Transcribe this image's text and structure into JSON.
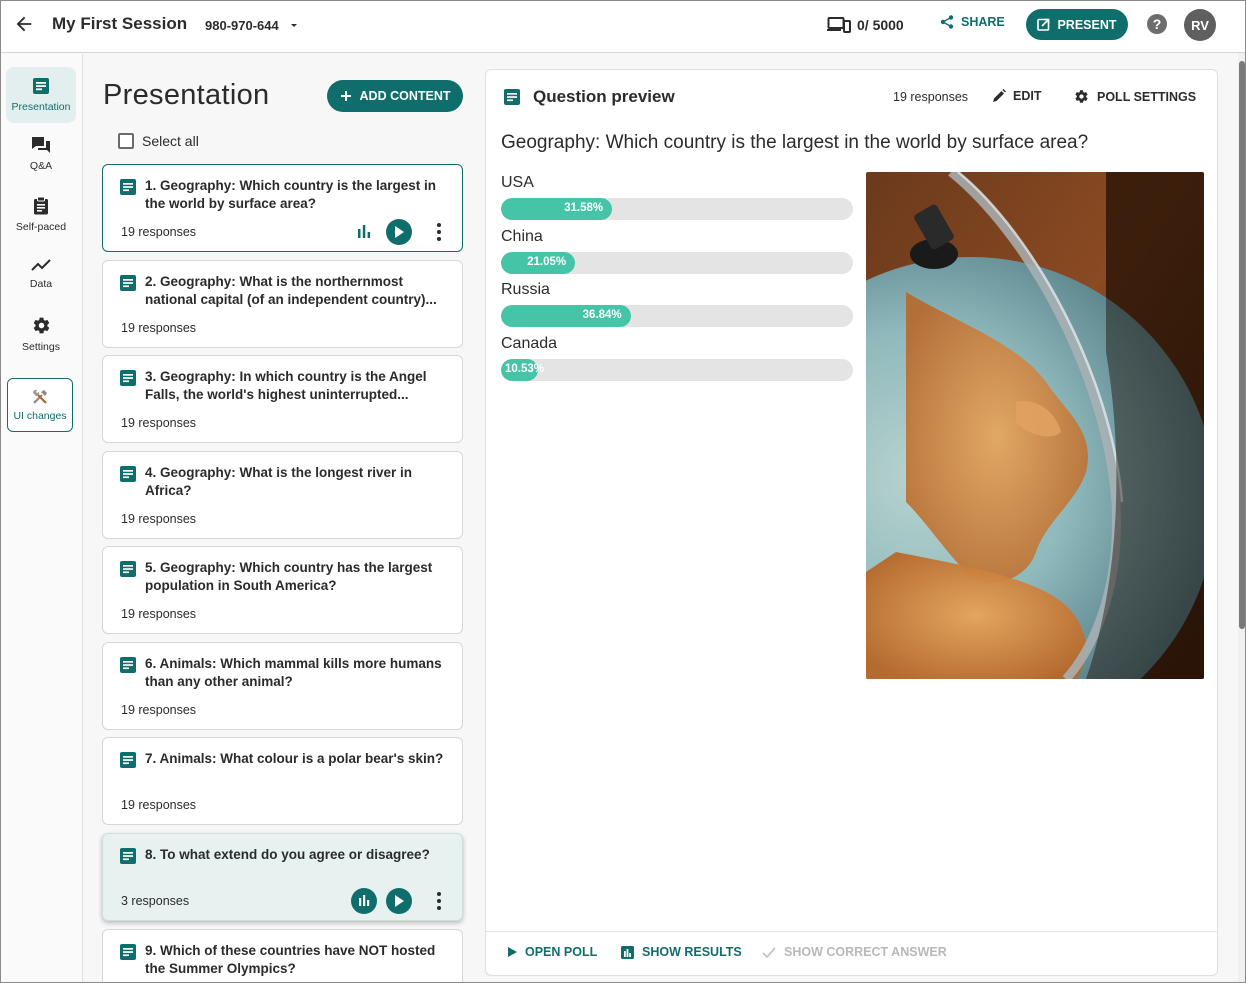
{
  "header": {
    "session_title": "My First Session",
    "session_code": "980-970-644",
    "device_count": "0/ 5000",
    "share_label": "SHARE",
    "present_label": "PRESENT",
    "help_label": "?",
    "avatar_initials": "RV"
  },
  "rail": {
    "items": [
      {
        "label": "Presentation"
      },
      {
        "label": "Q&A"
      },
      {
        "label": "Self-paced"
      },
      {
        "label": "Data"
      },
      {
        "label": "Settings"
      }
    ],
    "ui_changes_label": "UI changes"
  },
  "presentation": {
    "title": "Presentation",
    "add_content_label": "ADD CONTENT",
    "select_all_label": "Select all",
    "questions": [
      {
        "text": "1. Geography: Which country is the largest in the world by surface area?",
        "responses": "19 responses"
      },
      {
        "text": "2. Geography: What is the northernmost national capital (of an independent country)...",
        "responses": "19 responses"
      },
      {
        "text": "3. Geography: In which country is the Angel Falls, the world's highest uninterrupted...",
        "responses": "19 responses"
      },
      {
        "text": "4. Geography: What is the longest river in Africa?",
        "responses": "19 responses"
      },
      {
        "text": "5. Geography: Which country has the largest population in South America?",
        "responses": "19 responses"
      },
      {
        "text": "6. Animals: Which mammal kills more humans than any other animal?",
        "responses": "19 responses"
      },
      {
        "text": "7. Animals: What colour is a polar bear's skin?",
        "responses": "19 responses"
      },
      {
        "text": "8. To what extend do you agree or disagree?",
        "responses": "3 responses"
      },
      {
        "text": "9. Which of these countries have NOT hosted the Summer Olympics?",
        "responses": ""
      }
    ]
  },
  "preview": {
    "title": "Question preview",
    "responses": "19 responses",
    "edit_label": "EDIT",
    "poll_settings_label": "POLL SETTINGS",
    "question": "Geography: Which country is the largest in the world by surface area?",
    "options": [
      {
        "name": "USA",
        "percent_label": "31.58%",
        "percent": 31.58
      },
      {
        "name": "China",
        "percent_label": "21.05%",
        "percent": 21.05
      },
      {
        "name": "Russia",
        "percent_label": "36.84%",
        "percent": 36.84
      },
      {
        "name": "Canada",
        "percent_label": "10.53%",
        "percent": 10.53
      }
    ],
    "footer": {
      "open_poll_label": "OPEN POLL",
      "show_results_label": "SHOW RESULTS",
      "show_correct_label": "SHOW CORRECT ANSWER"
    }
  },
  "colors": {
    "brand": "#0f6e6b",
    "bar_fill": "#45c4a8",
    "bar_track": "#e4e4e4"
  }
}
